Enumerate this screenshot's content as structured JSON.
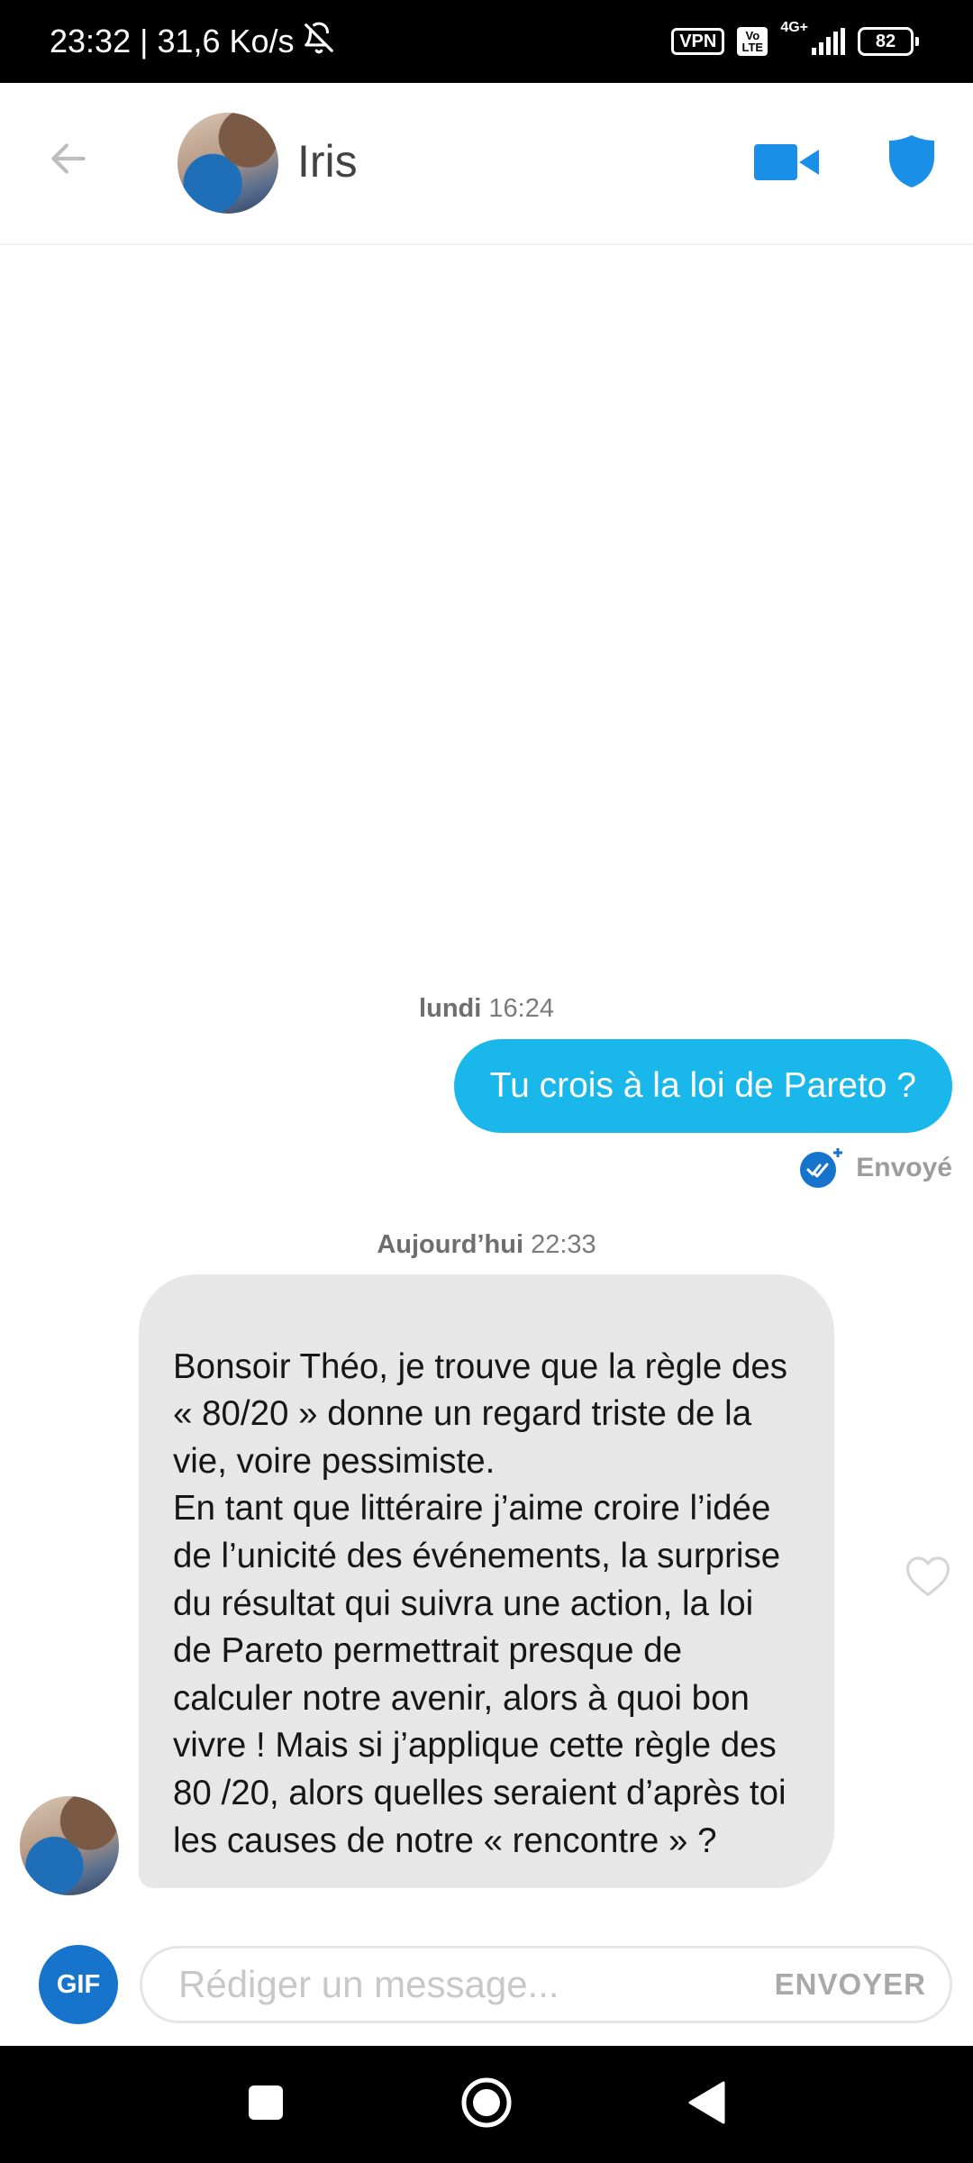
{
  "status_bar": {
    "time_speed": "23:32 | 31,6 Ko/s",
    "vpn": "VPN",
    "volte_top": "Vo",
    "volte_bottom": "LTE",
    "network": "4G+",
    "battery": "82",
    "icons": [
      "bell-off-icon",
      "signal-icon",
      "battery-icon"
    ]
  },
  "header": {
    "contact_name": "Iris",
    "icons": [
      "back-arrow-icon",
      "video-camera-icon",
      "shield-icon"
    ],
    "accent_color": "#1a8fe8"
  },
  "conversation": {
    "sent": {
      "day": "lundi",
      "time": "16:24",
      "text": "Tu crois à la loi de Pareto ?",
      "status": "Envoyé",
      "bubble_color": "#1ab7ea"
    },
    "received": {
      "day": "Aujourd’hui",
      "time": "22:33",
      "text": "Bonsoir Théo, je trouve que la règle des « 80/20 » donne un regard triste de la vie, voire pessimiste.\nEn tant que littéraire j’aime croire l’idée de l’unicité des événements, la surprise du résultat qui suivra une action, la loi de Pareto permettrait presque de calculer notre avenir, alors à quoi bon vivre ! Mais si j’applique cette règle des 80 /20, alors quelles seraient d’après toi les causes de notre « rencontre » ?",
      "bubble_color": "#e7e7e7"
    }
  },
  "composer": {
    "gif_label": "GIF",
    "placeholder": "Rédiger un message...",
    "value": "",
    "send_label": "ENVOYER"
  },
  "nav_bar": {
    "icons": [
      "recent-apps-icon",
      "home-icon",
      "back-triangle-icon"
    ]
  }
}
